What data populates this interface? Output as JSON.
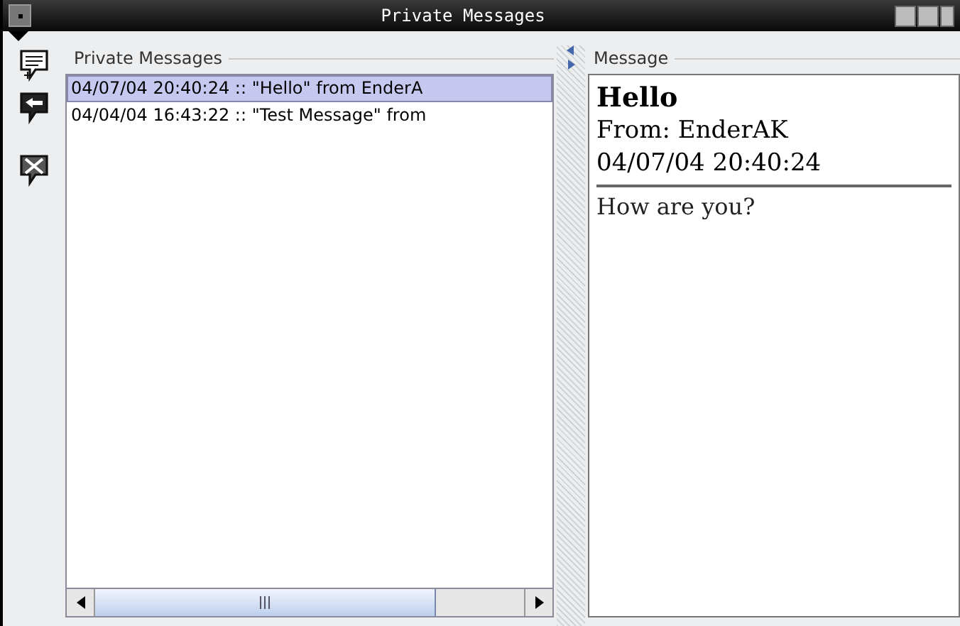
{
  "window": {
    "title": "Private Messages"
  },
  "list_panel": {
    "title": "Private Messages",
    "items": [
      {
        "text": "04/07/04 20:40:24 :: \"Hello\" from EnderA",
        "selected": true
      },
      {
        "text": "04/04/04 16:43:22 :: \"Test Message\" from",
        "selected": false
      }
    ]
  },
  "message_panel": {
    "title": "Message",
    "subject": "Hello",
    "from": "From: EnderAK",
    "date": "04/07/04 20:40:24",
    "body": "How are you?"
  }
}
